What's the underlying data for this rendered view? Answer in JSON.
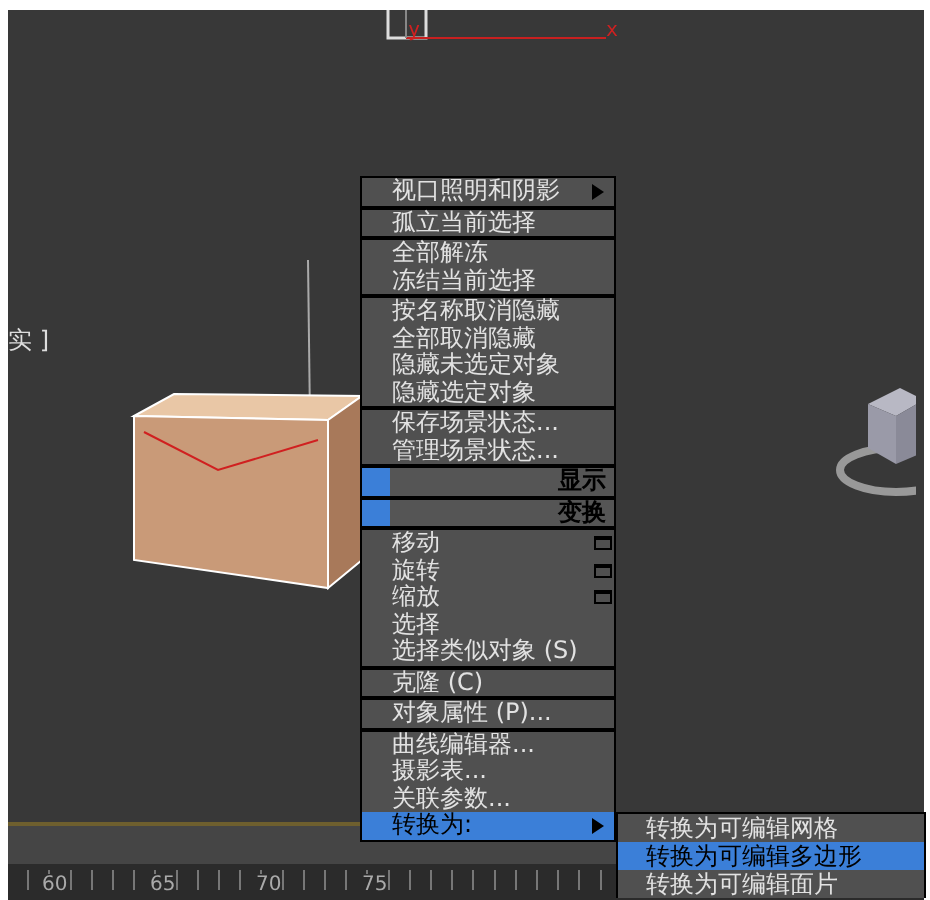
{
  "viewport": {
    "label": "实 ]",
    "axis_y": "y",
    "axis_x": "x"
  },
  "ruler": {
    "labels": [
      "60",
      "65",
      "70",
      "75"
    ]
  },
  "menu": {
    "sections": [
      {
        "kind": "group",
        "items": [
          {
            "label": "视口照明和阴影",
            "kind": "submenu",
            "selected": false
          }
        ]
      },
      {
        "kind": "group",
        "items": [
          {
            "label": "孤立当前选择",
            "kind": "plain",
            "selected": false
          }
        ]
      },
      {
        "kind": "group",
        "items": [
          {
            "label": "全部解冻",
            "kind": "plain",
            "selected": false
          },
          {
            "label": "冻结当前选择",
            "kind": "plain",
            "selected": false
          }
        ]
      },
      {
        "kind": "group",
        "items": [
          {
            "label": "按名称取消隐藏",
            "kind": "plain",
            "selected": false
          },
          {
            "label": "全部取消隐藏",
            "kind": "plain",
            "selected": false
          },
          {
            "label": "隐藏未选定对象",
            "kind": "plain",
            "selected": false
          },
          {
            "label": "隐藏选定对象",
            "kind": "plain",
            "selected": false
          }
        ]
      },
      {
        "kind": "group",
        "items": [
          {
            "label": "保存场景状态...",
            "kind": "plain",
            "selected": false
          },
          {
            "label": "管理场景状态...",
            "kind": "plain",
            "selected": false
          }
        ]
      },
      {
        "kind": "header",
        "label": "显示"
      },
      {
        "kind": "header",
        "label": "变换"
      },
      {
        "kind": "group",
        "items": [
          {
            "label": "移动",
            "kind": "options",
            "selected": false
          },
          {
            "label": "旋转",
            "kind": "options",
            "selected": false
          },
          {
            "label": "缩放",
            "kind": "options",
            "selected": false
          },
          {
            "label": "选择",
            "kind": "plain",
            "selected": false
          },
          {
            "label": "选择类似对象 (S)",
            "kind": "plain",
            "selected": false
          }
        ]
      },
      {
        "kind": "group",
        "items": [
          {
            "label": "克隆 (C)",
            "kind": "plain",
            "selected": false
          }
        ]
      },
      {
        "kind": "group",
        "items": [
          {
            "label": "对象属性 (P)...",
            "kind": "plain",
            "selected": false
          }
        ]
      },
      {
        "kind": "group",
        "items": [
          {
            "label": "曲线编辑器...",
            "kind": "plain",
            "selected": false
          },
          {
            "label": "摄影表...",
            "kind": "plain",
            "selected": false
          },
          {
            "label": "关联参数...",
            "kind": "plain",
            "selected": false
          },
          {
            "label": "转换为:",
            "kind": "submenu",
            "selected": true
          }
        ]
      }
    ]
  },
  "submenu": {
    "items": [
      {
        "label": "转换为可编辑网格",
        "selected": false
      },
      {
        "label": "转换为可编辑多边形",
        "selected": true
      },
      {
        "label": "转换为可编辑面片",
        "selected": false
      }
    ]
  }
}
